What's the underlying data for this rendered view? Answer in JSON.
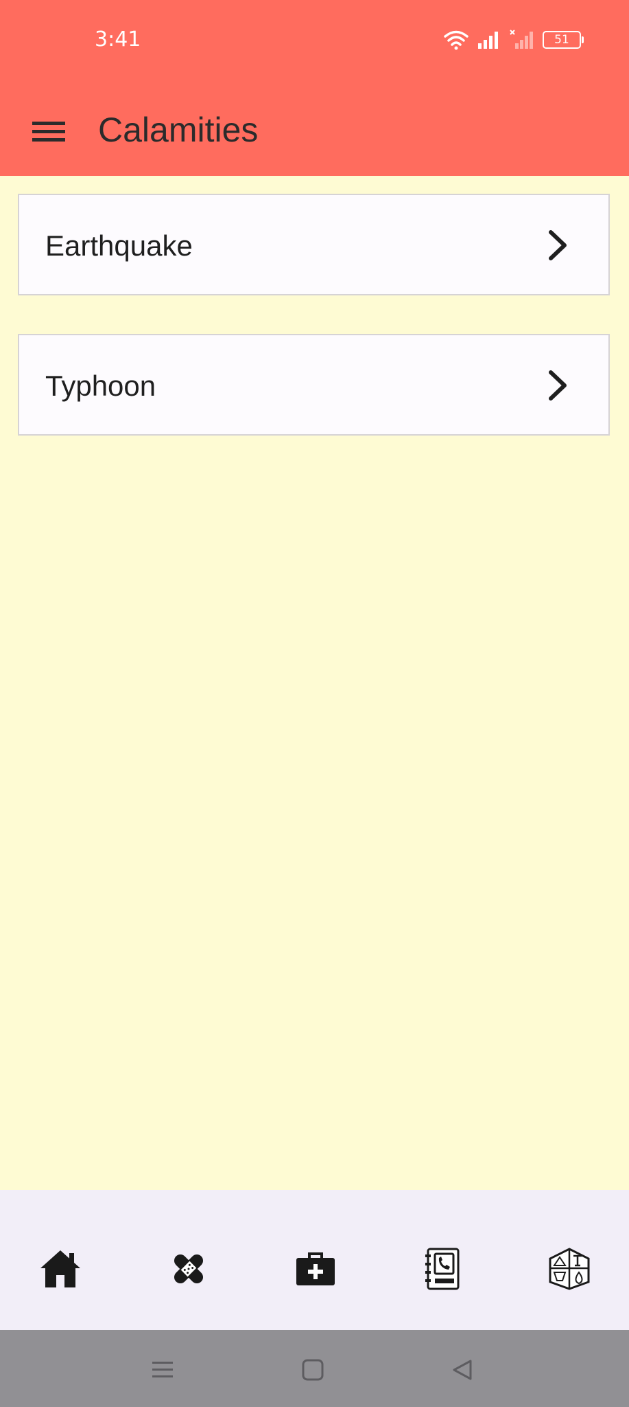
{
  "status_bar": {
    "time": "3:41",
    "battery": "51"
  },
  "app_bar": {
    "title": "Calamities",
    "menu_icon": "menu-icon"
  },
  "items": [
    {
      "label": "Earthquake",
      "icon": "chevron-right-icon"
    },
    {
      "label": "Typhoon",
      "icon": "chevron-right-icon"
    }
  ],
  "bottom_nav": [
    {
      "icon": "home-icon"
    },
    {
      "icon": "bandage-icon"
    },
    {
      "icon": "first-aid-kit-icon"
    },
    {
      "icon": "phone-directory-icon"
    },
    {
      "icon": "emergency-supplies-icon"
    }
  ],
  "colors": {
    "header": "#ff6c5e",
    "background": "#fefbd3",
    "card": "#fdfbfe",
    "bottom_nav": "#f2eef8",
    "system_nav": "#919094"
  }
}
